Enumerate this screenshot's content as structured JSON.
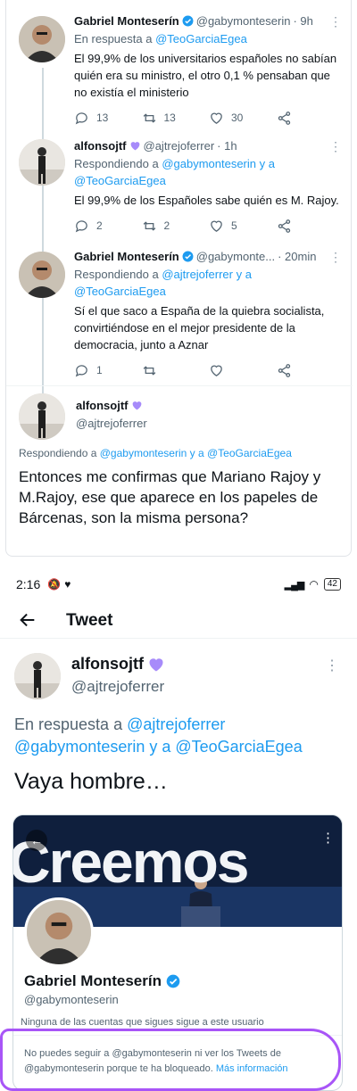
{
  "shot1": {
    "tweets": [
      {
        "name": "Gabriel Monteserín",
        "handle": "@gabymonteserin",
        "time": "· 9h",
        "reply_prefix": "En respuesta a ",
        "reply_users": "@TeoGarciaEgea",
        "reply_tail": "",
        "text": "El 99,9% de los universitarios españoles no sabían quién era su ministro, el otro 0,1 % pensaban que no existía el ministerio",
        "replies": "13",
        "retweets": "13",
        "likes": "30"
      },
      {
        "name": "alfonsojtf",
        "handle": "@ajtrejoferrer",
        "time": "· 1h",
        "reply_prefix": "Respondiendo a ",
        "reply_users": "@gabymonteserin y a @TeoGarciaEgea",
        "reply_tail": "",
        "text": "El 99,9% de los Españoles sabe quién es M. Rajoy.",
        "replies": "2",
        "retweets": "2",
        "likes": "5"
      },
      {
        "name": "Gabriel Monteserín",
        "handle": "@gabymonte...",
        "time": "· 20min",
        "reply_prefix": "Respondiendo a ",
        "reply_users": "@ajtrejoferrer y a @TeoGarciaEgea",
        "reply_tail": "",
        "text": "Sí el que saco a España de la quiebra socialista, convirtiéndose en el mejor presidente de la democracia, junto a Aznar",
        "replies": "1",
        "retweets": "",
        "likes": ""
      }
    ],
    "focused": {
      "name": "alfonsojtf",
      "handle": "@ajtrejoferrer",
      "reply_prefix": "Respondiendo a ",
      "reply_users": "@gabymonteserin y a @TeoGarciaEgea",
      "text": "Entonces me confirmas que Mariano Rajoy y M.Rajoy, ese que aparece en los papeles de Bárcenas, son la misma persona?"
    }
  },
  "status": {
    "time": "2:16",
    "battery": "42"
  },
  "appbar": {
    "title": "Tweet"
  },
  "main": {
    "name": "alfonsojtf",
    "handle": "@ajtrejoferrer",
    "reply_prefix": "En respuesta a ",
    "reply_user1": "@ajtrejoferrer",
    "reply_line2": "@gabymonteserin y a @TeoGarciaEgea",
    "text": "Vaya hombre…"
  },
  "card": {
    "banner_word": "Creemos",
    "name": "Gabriel Monteserín",
    "handle": "@gabymonteserin",
    "follow_note": "Ninguna de las cuentas que sigues sigue a este usuario",
    "blocked_text": "No puedes seguir a @gabymonteserin ni ver los Tweets de @gabymonteserin porque te ha bloqueado.",
    "more_info": "Más información"
  },
  "colors": {
    "accent": "#1d9bf0",
    "verified": "#1d9bf0",
    "heart_purple": "#a78bfa",
    "highlight": "#a855f7"
  }
}
